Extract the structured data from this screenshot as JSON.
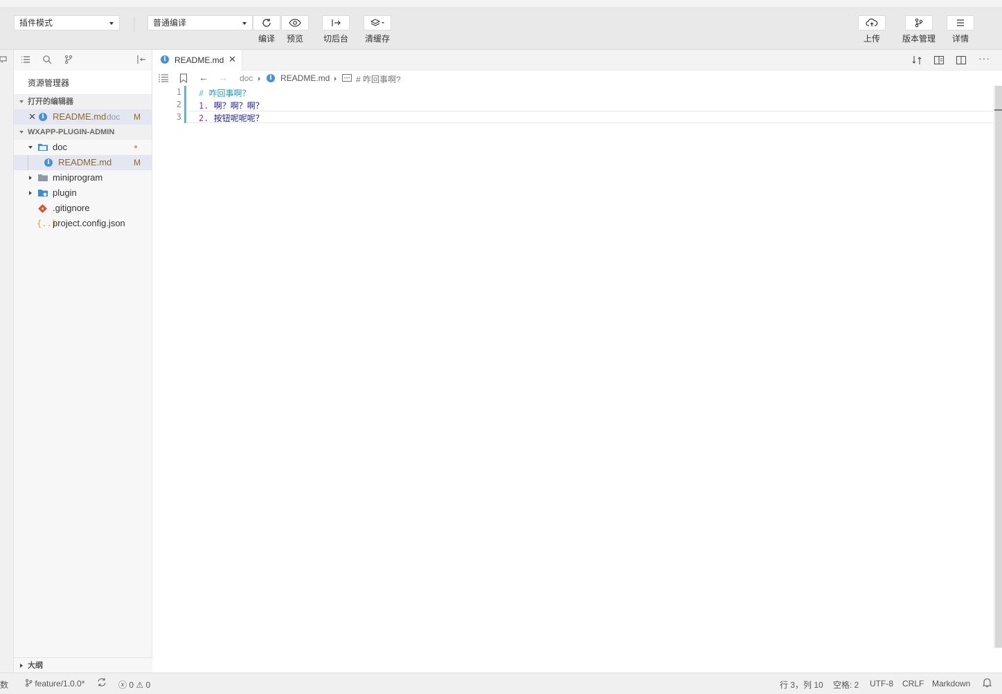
{
  "toolbar": {
    "mode_select": "插件模式",
    "compile_select": "普通编译",
    "compile_label": "编译",
    "preview_label": "预览",
    "backstage_label": "切后台",
    "clear_cache_label": "清缓存",
    "upload_label": "上传",
    "version_label": "版本管理",
    "details_label": "详情"
  },
  "sidebar": {
    "title": "资源管理器",
    "open_editors_header": "打开的编辑器",
    "open_editor": {
      "name": "README.md",
      "folder": "doc",
      "badge": "M"
    },
    "project_header": "WXAPP-PLUGIN-ADMIN",
    "tree": [
      {
        "name": "doc",
        "badge": "●"
      },
      {
        "name": "README.md",
        "badge": "M"
      },
      {
        "name": "miniprogram"
      },
      {
        "name": "plugin"
      },
      {
        "name": ".gitignore"
      },
      {
        "name": "project.config.json"
      }
    ],
    "outline_header": "大纲"
  },
  "editor": {
    "tab_label": "README.md",
    "breadcrumb": {
      "folder": "doc",
      "file": "README.md",
      "symbol": "# 咋回事啊?"
    },
    "lines": [
      {
        "num": "1",
        "marker": "#",
        "text": "咋回事啊？"
      },
      {
        "num": "2",
        "marker": "1.",
        "text": "啊？啊？啊？"
      },
      {
        "num": "3",
        "marker": "2.",
        "text": "按钮呢呢呢？"
      }
    ]
  },
  "status": {
    "left_cut": "数",
    "branch": "feature/1.0.0*",
    "errors": "0",
    "warnings": "0",
    "position": "行 3，列 10",
    "spaces": "空格: 2",
    "encoding": "UTF-8",
    "eol": "CRLF",
    "language": "Markdown"
  },
  "colors": {
    "accent": "#4a90d9",
    "heading": "#1e9cba",
    "list_marker": "#a626a4",
    "text": "#1a1aa6",
    "badge": "#8a6b2a"
  }
}
